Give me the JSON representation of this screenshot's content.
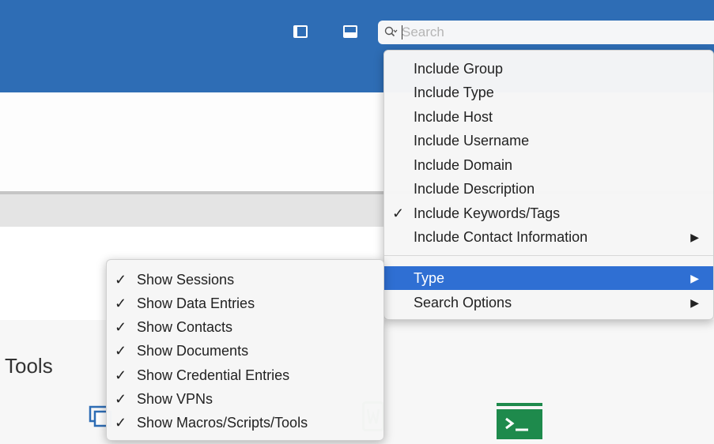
{
  "search": {
    "placeholder": "Search"
  },
  "content": {
    "tools_label": "Tools"
  },
  "main_menu": {
    "items": [
      {
        "label": "Include Group",
        "checked": false
      },
      {
        "label": "Include Type",
        "checked": false
      },
      {
        "label": "Include Host",
        "checked": false
      },
      {
        "label": "Include Username",
        "checked": false
      },
      {
        "label": "Include Domain",
        "checked": false
      },
      {
        "label": "Include Description",
        "checked": false
      },
      {
        "label": "Include Keywords/Tags",
        "checked": true,
        "check": "✓"
      },
      {
        "label": "Include Contact Information",
        "checked": false,
        "arrow": "▶"
      },
      {
        "label": "Type",
        "checked": false,
        "arrow": "▶",
        "highlighted": true
      },
      {
        "label": "Search Options",
        "checked": false,
        "arrow": "▶"
      }
    ]
  },
  "type_submenu": {
    "items": [
      {
        "label": "Show Sessions",
        "check": "✓"
      },
      {
        "label": "Show Data Entries",
        "check": "✓"
      },
      {
        "label": "Show Contacts",
        "check": "✓"
      },
      {
        "label": "Show Documents",
        "check": "✓"
      },
      {
        "label": "Show Credential Entries",
        "check": "✓"
      },
      {
        "label": "Show VPNs",
        "check": "✓"
      },
      {
        "label": "Show Macros/Scripts/Tools",
        "check": "✓"
      }
    ]
  },
  "colors": {
    "toolbar": "#2e6db5",
    "highlight": "#2f6fd3",
    "doc_icon": "#2e8b3c",
    "terminal_icon": "#1e8a4c"
  },
  "icons": [
    "sidebar-toggle-icon",
    "bottom-panel-toggle-icon",
    "search-icon",
    "session-icon",
    "document-icon",
    "terminal-icon"
  ]
}
